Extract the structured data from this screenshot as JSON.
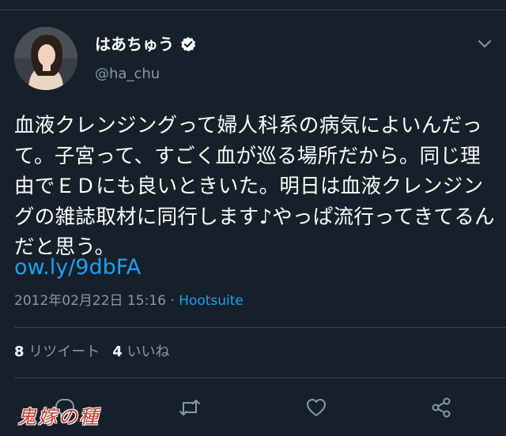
{
  "tweet": {
    "display_name": "はあちゅう",
    "handle": "@ha_chu",
    "text": "血液クレンジングって婦人科系の病気によいんだって。子宮って、すごく血が巡る場所だから。同じ理由でＥＤにも良いときいた。明日は血液クレンジングの雑誌取材に同行します♪やっぱ流行ってきてるんだと思う。",
    "link": "ow.ly/9dbFA",
    "timestamp": "2012年02月22日 15:16",
    "separator": " · ",
    "source": "Hootsuite"
  },
  "stats": {
    "retweets_count": "8",
    "retweets_label": "リツイート",
    "likes_count": "4",
    "likes_label": "いいね"
  },
  "watermark": "鬼嫁の種",
  "icons": {
    "verified": "verified-badge-icon",
    "menu": "chevron-down-icon",
    "reply": "reply-icon",
    "retweet": "retweet-icon",
    "like": "heart-icon",
    "share": "share-icon"
  },
  "colors": {
    "background": "#15202b",
    "text": "#ffffff",
    "secondary_text": "#8899a6",
    "accent": "#1da1f2",
    "divider": "#38444d",
    "watermark": "#c0392b"
  }
}
